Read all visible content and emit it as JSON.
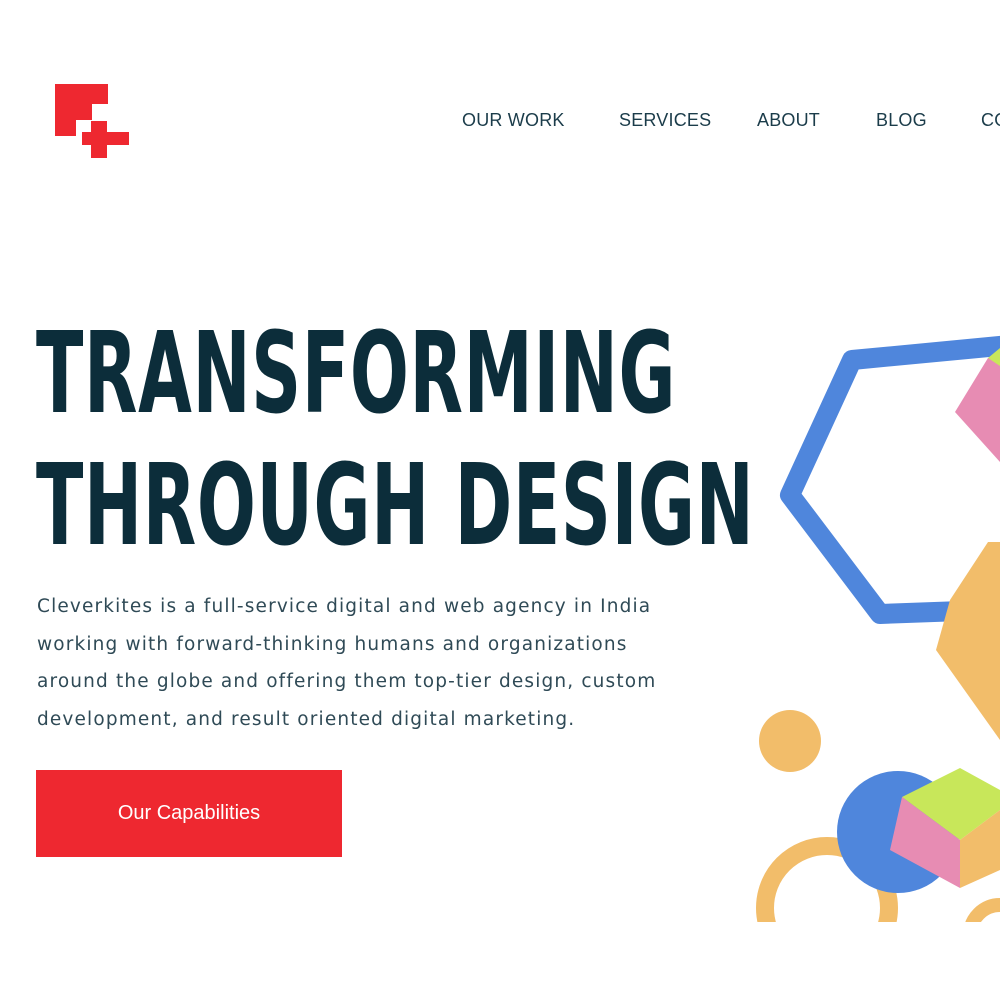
{
  "header": {
    "nav": [
      {
        "label": "OUR WORK"
      },
      {
        "label": "SERVICES"
      },
      {
        "label": "ABOUT"
      },
      {
        "label": "BLOG"
      },
      {
        "label": "CO"
      }
    ]
  },
  "hero": {
    "title_line1": "TRANSFORMING",
    "title_line2": "THROUGH DESIGN",
    "description_line1": "Cleverkites is a full-service digital and web agency in India",
    "description_line2": "working with forward-thinking humans and organizations",
    "description_line3": "around the globe and offering them top-tier design, custom",
    "description_line4": "development, and result oriented digital marketing.",
    "cta_label": "Our Capabilities"
  },
  "colors": {
    "brand_red": "#ee2830",
    "heading": "#0c2d3a",
    "hex_blue": "#4f86dc",
    "orange": "#f2bd6a",
    "pink": "#e78cb3",
    "lime": "#c8e75a"
  },
  "icons": [
    "logo-mark",
    "decorative-shapes"
  ]
}
